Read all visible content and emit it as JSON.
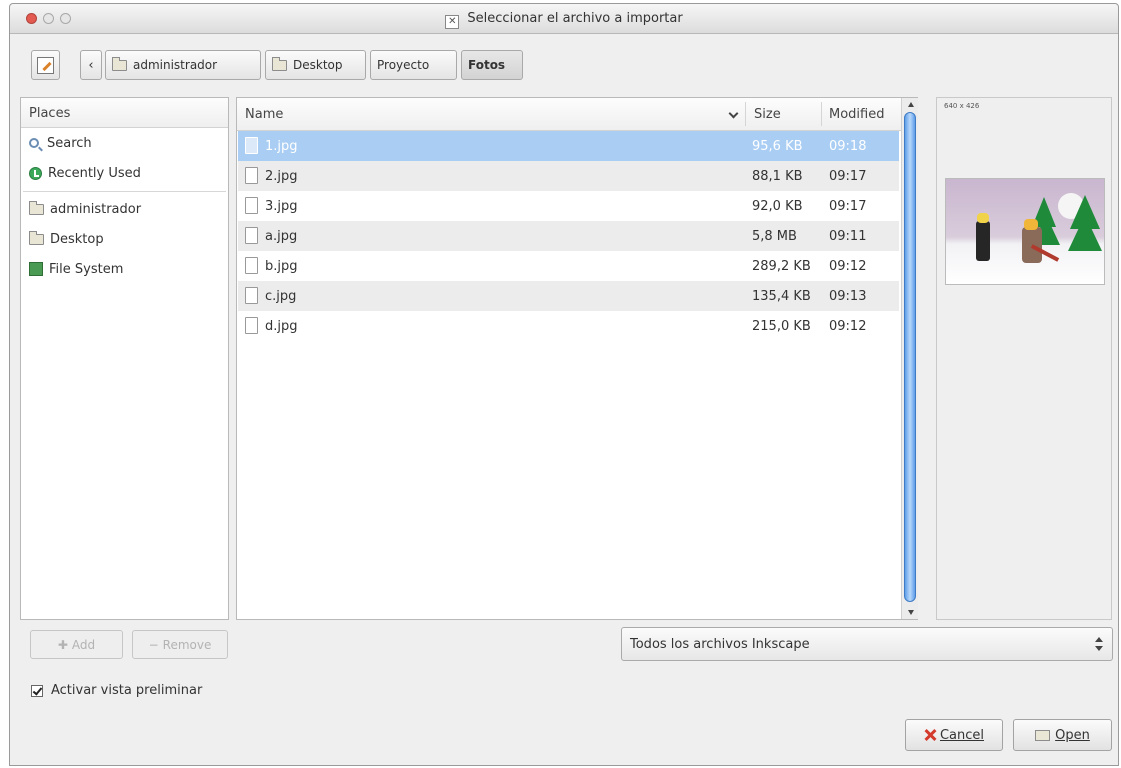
{
  "window": {
    "title": "Seleccionar el archivo a importar"
  },
  "pathbar": {
    "crumbs": [
      "administrador",
      "Desktop",
      "Proyecto",
      "Fotos"
    ]
  },
  "places": {
    "header": "Places",
    "items": [
      {
        "label": "Search",
        "icon": "search-icon"
      },
      {
        "label": "Recently Used",
        "icon": "recent-icon"
      },
      {
        "label": "administrador",
        "icon": "folder-icon"
      },
      {
        "label": "Desktop",
        "icon": "folder-icon"
      },
      {
        "label": "File System",
        "icon": "filesystem-icon"
      }
    ],
    "add_label": "Add",
    "remove_label": "Remove"
  },
  "files": {
    "columns": {
      "name": "Name",
      "size": "Size",
      "modified": "Modified"
    },
    "rows": [
      {
        "name": "1.jpg",
        "size": "95,6 KB",
        "modified": "09:18",
        "selected": true
      },
      {
        "name": "2.jpg",
        "size": "88,1 KB",
        "modified": "09:17"
      },
      {
        "name": "3.jpg",
        "size": "92,0 KB",
        "modified": "09:17"
      },
      {
        "name": "a.jpg",
        "size": "5,8 MB",
        "modified": "09:11"
      },
      {
        "name": "b.jpg",
        "size": "289,2 KB",
        "modified": "09:12"
      },
      {
        "name": "c.jpg",
        "size": "135,4 KB",
        "modified": "09:13"
      },
      {
        "name": "d.jpg",
        "size": "215,0 KB",
        "modified": "09:12"
      }
    ]
  },
  "preview": {
    "dimensions": "640 x 426"
  },
  "filter": {
    "selected": "Todos los archivos Inkscape"
  },
  "options": {
    "preview_label": "Activar vista preliminar",
    "preview_checked": true
  },
  "buttons": {
    "cancel_label": "Cancel",
    "open_label": "Open"
  },
  "colors": {
    "selection": "#a9cdf3",
    "scroll_thumb": "#5e9ee8",
    "close_button": "#e25a50"
  }
}
